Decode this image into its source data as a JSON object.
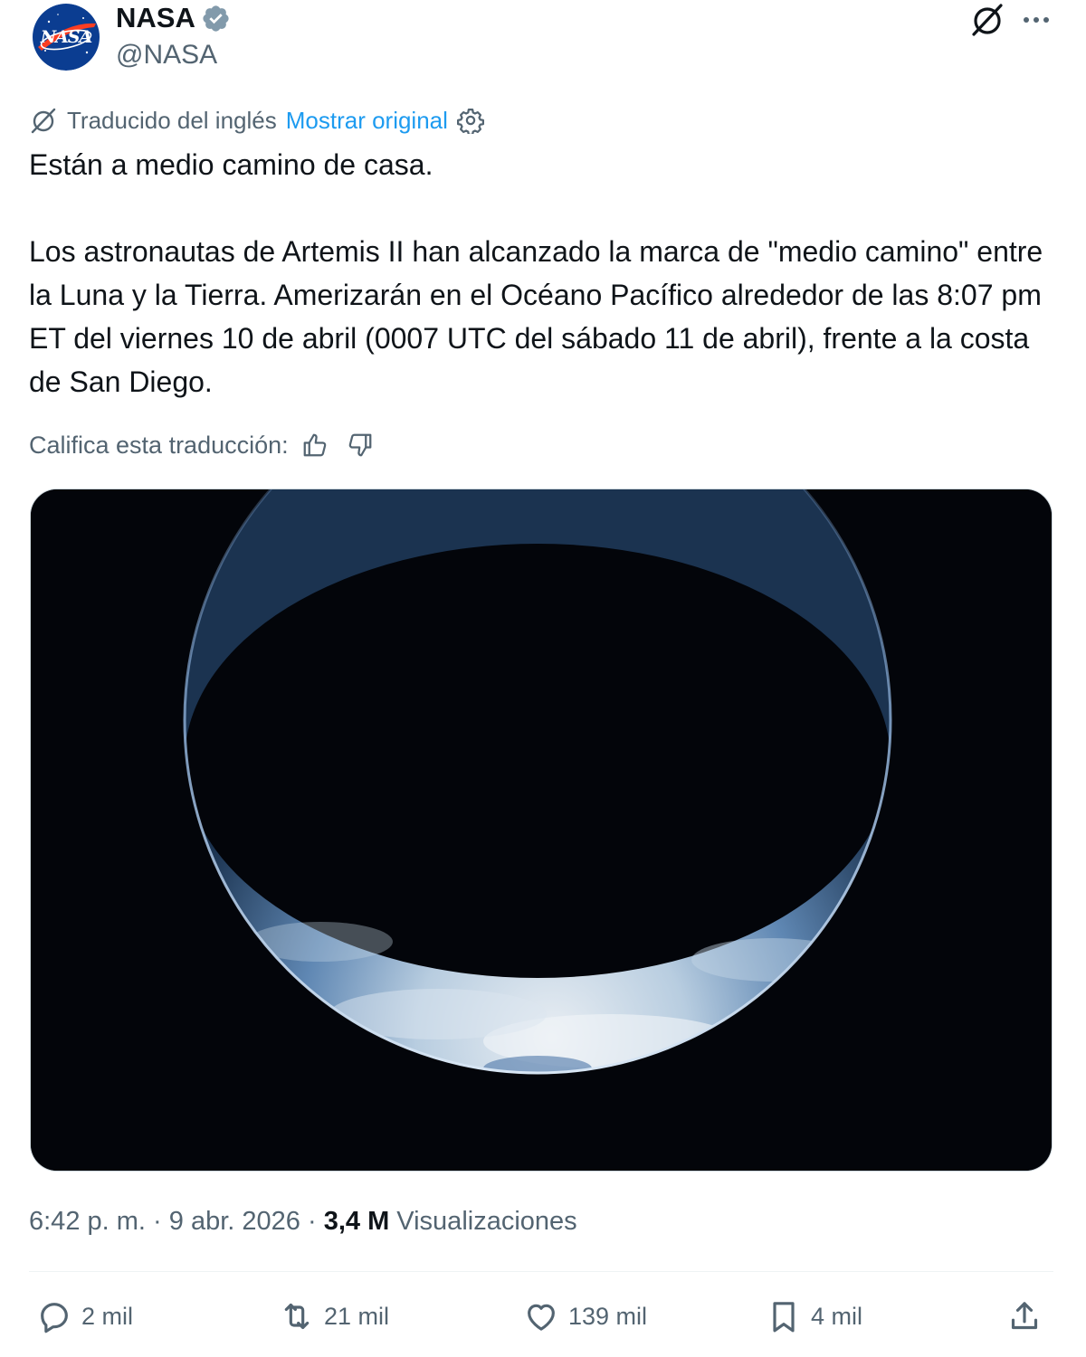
{
  "author": {
    "display_name": "NASA",
    "handle": "@NASA",
    "avatar_text": "NASA",
    "verified_icon": "verified-badge-icon",
    "brand_color": "#0b3d91",
    "accent_red": "#fc3d21"
  },
  "top_actions": {
    "grok_icon": "grok-icon",
    "more_icon": "more-icon"
  },
  "translation": {
    "label": "Traducido del inglés",
    "show_original": "Mostrar original",
    "settings_icon": "gear-icon"
  },
  "tweet": {
    "text": "Están a medio camino de casa.\n\nLos astronautas de Artemis II han alcanzado la marca de \"medio camino\" entre la Luna y la Tierra. Amerizarán en el Océano Pacífico alrededor de las 8:07 pm ET del viernes 10 de abril (0007 UTC del sábado 11 de abril), frente a la costa de San Diego."
  },
  "rating": {
    "label": "Califica esta traducción:",
    "up_icon": "thumbs-up-icon",
    "down_icon": "thumbs-down-icon"
  },
  "media": {
    "description_icon": "earth-crescent-image"
  },
  "meta": {
    "time": "6:42 p. m.",
    "date": "9 abr. 2026",
    "separator": "·",
    "views_count": "3,4 M",
    "views_label": "Visualizaciones"
  },
  "actions": {
    "replies": "2 mil",
    "reposts": "21 mil",
    "likes": "139 mil",
    "bookmarks": "4 mil"
  },
  "colors": {
    "text": "#0f1419",
    "secondary": "#536471",
    "link": "#1d9bf0",
    "divider": "#eff3f4"
  }
}
